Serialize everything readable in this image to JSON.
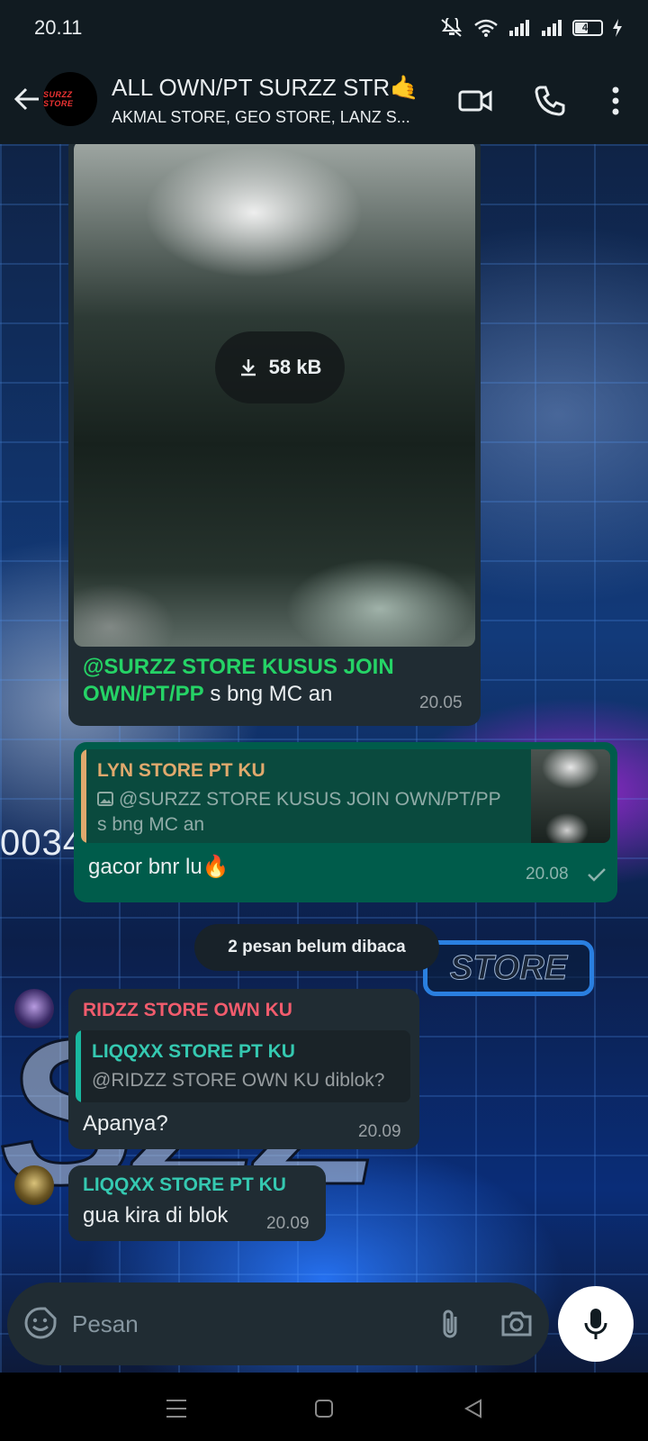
{
  "status_bar": {
    "time": "20.11",
    "battery_level": "48",
    "icons": [
      "mute-icon",
      "wifi-icon",
      "signal-icon",
      "signal-icon",
      "battery-icon",
      "charging-icon"
    ]
  },
  "header": {
    "title": "ALL OWN/PT SURZZ STR🤙",
    "subtitle": "AKMAL STORE, GEO STORE, LANZ S...",
    "avatar_text": "SURZZ STORE",
    "icons": [
      "back-arrow-icon",
      "video-call-icon",
      "phone-icon",
      "more-vert-icon"
    ]
  },
  "wallpaper": {
    "digits": "0034",
    "store_label": "STORE",
    "big_text": "SZZ"
  },
  "messages": {
    "m1": {
      "download_size": "58 kB",
      "caption_mention": "@SURZZ STORE KUSUS JOIN OWN/PT/PP",
      "caption_text": " s bng MC an",
      "time": "20.05"
    },
    "m2": {
      "quoted_name": "LYN STORE PT KU",
      "quoted_text": "@SURZZ STORE KUSUS JOIN OWN/PT/PP s bng MC an",
      "text": "gacor bnr lu🔥",
      "time": "20.08",
      "status": "sent"
    },
    "unread_banner": "2 pesan belum dibaca",
    "m3": {
      "sender": "RIDZZ STORE OWN KU",
      "quoted_name": "LIQQXX STORE PT KU",
      "quoted_text": "@RIDZZ STORE OWN KU diblok?",
      "text": "Apanya?",
      "time": "20.09"
    },
    "m4": {
      "sender": "LIQQXX STORE PT KU",
      "text": "gua kira di blok",
      "time": "20.09"
    }
  },
  "composer": {
    "placeholder": "Pesan",
    "icons": [
      "sticker-icon",
      "paperclip-icon",
      "camera-icon",
      "mic-icon"
    ]
  },
  "colors": {
    "app_bar": "#111b21",
    "incoming_bubble": "#202c33",
    "outgoing_bubble": "#005c4b",
    "mention_green": "#25d366",
    "sender_red": "#f15c6d",
    "sender_teal": "#35c9b1",
    "quote_orange": "#e0a96d"
  }
}
